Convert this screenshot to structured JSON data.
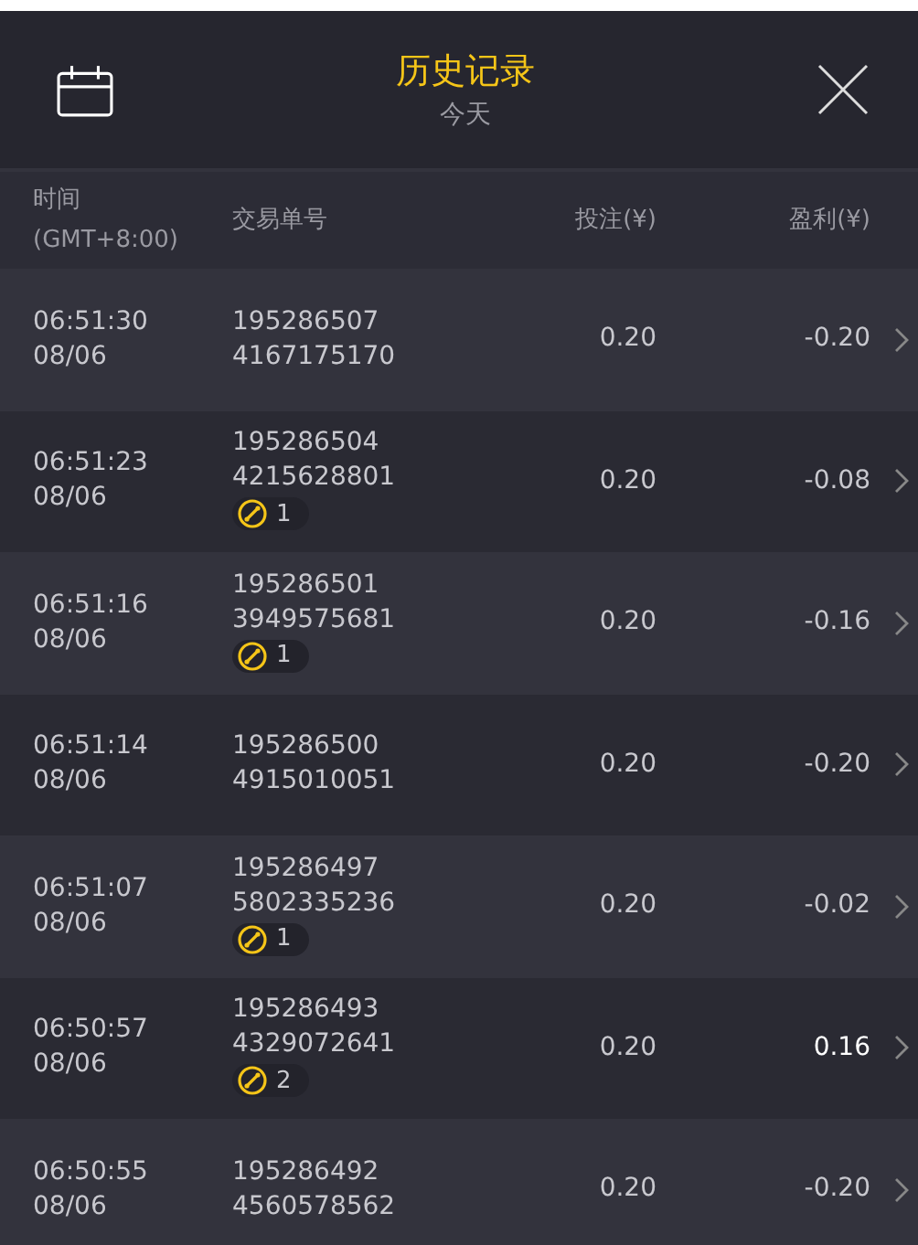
{
  "header": {
    "title": "历史记录",
    "subtitle": "今天"
  },
  "columns": {
    "time": "时间",
    "timezone": "(GMT+8:00)",
    "order": "交易单号",
    "stake": "投注(¥)",
    "profit": "盈利(¥)"
  },
  "rows": [
    {
      "time": "06:51:30",
      "date": "08/06",
      "order_id": "195286507",
      "order_no": "4167175170",
      "stake": "0.20",
      "profit": "-0.20",
      "positive": false
    },
    {
      "time": "06:51:23",
      "date": "08/06",
      "order_id": "195286504",
      "order_no": "4215628801",
      "badge": "1",
      "stake": "0.20",
      "profit": "-0.08",
      "positive": false
    },
    {
      "time": "06:51:16",
      "date": "08/06",
      "order_id": "195286501",
      "order_no": "3949575681",
      "badge": "1",
      "stake": "0.20",
      "profit": "-0.16",
      "positive": false
    },
    {
      "time": "06:51:14",
      "date": "08/06",
      "order_id": "195286500",
      "order_no": "4915010051",
      "stake": "0.20",
      "profit": "-0.20",
      "positive": false
    },
    {
      "time": "06:51:07",
      "date": "08/06",
      "order_id": "195286497",
      "order_no": "5802335236",
      "badge": "1",
      "stake": "0.20",
      "profit": "-0.02",
      "positive": false
    },
    {
      "time": "06:50:57",
      "date": "08/06",
      "order_id": "195286493",
      "order_no": "4329072641",
      "badge": "2",
      "stake": "0.20",
      "profit": "0.16",
      "positive": true
    },
    {
      "time": "06:50:55",
      "date": "08/06",
      "order_id": "195286492",
      "order_no": "4560578562",
      "stake": "0.20",
      "profit": "-0.20",
      "positive": false
    }
  ]
}
